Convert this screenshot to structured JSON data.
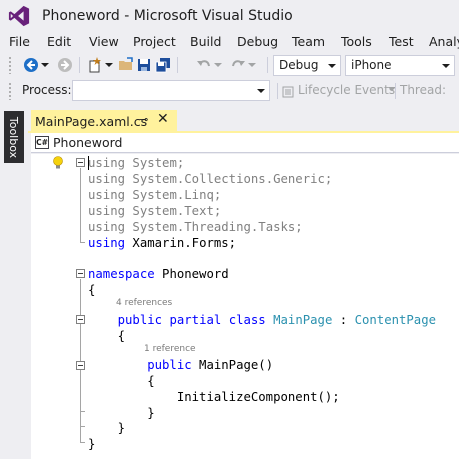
{
  "window": {
    "title": "Phoneword - Microsoft Visual Studio"
  },
  "menu": [
    "File",
    "Edit",
    "View",
    "Project",
    "Build",
    "Debug",
    "Team",
    "Tools",
    "Test",
    "Analy"
  ],
  "toolbar": {
    "config_value": "Debug",
    "platform_value": "iPhone"
  },
  "debug_location": {
    "process_label": "Process:",
    "process_value": "",
    "lifecycle_label": "Lifecycle Events",
    "thread_label": "Thread:"
  },
  "toolbox": {
    "label": "Toolbox"
  },
  "document_tab": {
    "name": "MainPage.xaml.cs",
    "pin_glyph": "⊸",
    "close_glyph": "✕"
  },
  "navigation": {
    "icon_text": "C#",
    "project": "Phoneword"
  },
  "code": {
    "lines": [
      {
        "parts": [
          {
            "t": "using",
            "c": "dim-kw"
          },
          {
            "t": " System;",
            "c": "dim"
          }
        ]
      },
      {
        "parts": [
          {
            "t": "using",
            "c": "dim-kw"
          },
          {
            "t": " System.Collections.Generic;",
            "c": "dim"
          }
        ]
      },
      {
        "parts": [
          {
            "t": "using",
            "c": "dim-kw"
          },
          {
            "t": " System.Linq;",
            "c": "dim"
          }
        ]
      },
      {
        "parts": [
          {
            "t": "using",
            "c": "dim-kw"
          },
          {
            "t": " System.Text;",
            "c": "dim"
          }
        ]
      },
      {
        "parts": [
          {
            "t": "using",
            "c": "dim-kw"
          },
          {
            "t": " System.Threading.Tasks;",
            "c": "dim"
          }
        ]
      },
      {
        "parts": [
          {
            "t": "using",
            "c": "kw"
          },
          {
            "t": " Xamarin.Forms;",
            "c": ""
          }
        ]
      },
      {
        "parts": []
      },
      {
        "parts": [
          {
            "t": "namespace",
            "c": "kw"
          },
          {
            "t": " Phoneword",
            "c": ""
          }
        ]
      },
      {
        "parts": [
          {
            "t": "{",
            "c": ""
          }
        ]
      },
      {
        "parts": [
          {
            "t": "    public",
            "c": "kw"
          },
          {
            "t": " ",
            "c": ""
          },
          {
            "t": "partial",
            "c": "kw"
          },
          {
            "t": " ",
            "c": ""
          },
          {
            "t": "class",
            "c": "kw"
          },
          {
            "t": " ",
            "c": ""
          },
          {
            "t": "MainPage",
            "c": "type"
          },
          {
            "t": " : ",
            "c": ""
          },
          {
            "t": "ContentPage",
            "c": "type"
          }
        ]
      },
      {
        "parts": [
          {
            "t": "    {",
            "c": ""
          }
        ]
      },
      {
        "parts": [
          {
            "t": "        public",
            "c": "kw"
          },
          {
            "t": " MainPage()",
            "c": ""
          }
        ]
      },
      {
        "parts": [
          {
            "t": "        {",
            "c": ""
          }
        ]
      },
      {
        "parts": [
          {
            "t": "            InitializeComponent();",
            "c": ""
          }
        ]
      },
      {
        "parts": [
          {
            "t": "        }",
            "c": ""
          }
        ]
      },
      {
        "parts": [
          {
            "t": "    }",
            "c": ""
          }
        ]
      },
      {
        "parts": [
          {
            "t": "}",
            "c": ""
          }
        ]
      }
    ],
    "lens": {
      "class_refs": "4 references",
      "ctor_refs": "1 reference"
    }
  },
  "colors": {
    "accent": "#68217A",
    "tab_active": "#FFF29D",
    "keyword": "#0000FF",
    "type": "#2B91AF",
    "dimmed": "#808080"
  }
}
